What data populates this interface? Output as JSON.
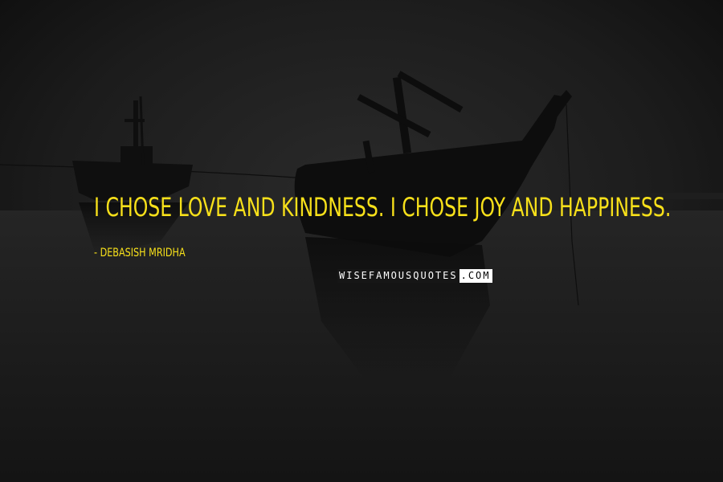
{
  "quote": {
    "text": "I chose love and kindness. I chose joy and happiness."
  },
  "author": {
    "text": "- Debasish Mridha"
  },
  "watermark": {
    "brand": "WISEFAMOUSQUOTES",
    "tld": ".COM"
  },
  "colors": {
    "quote_text": "#f7e01a",
    "background": "#161616",
    "watermark_light": "#ffffff"
  }
}
